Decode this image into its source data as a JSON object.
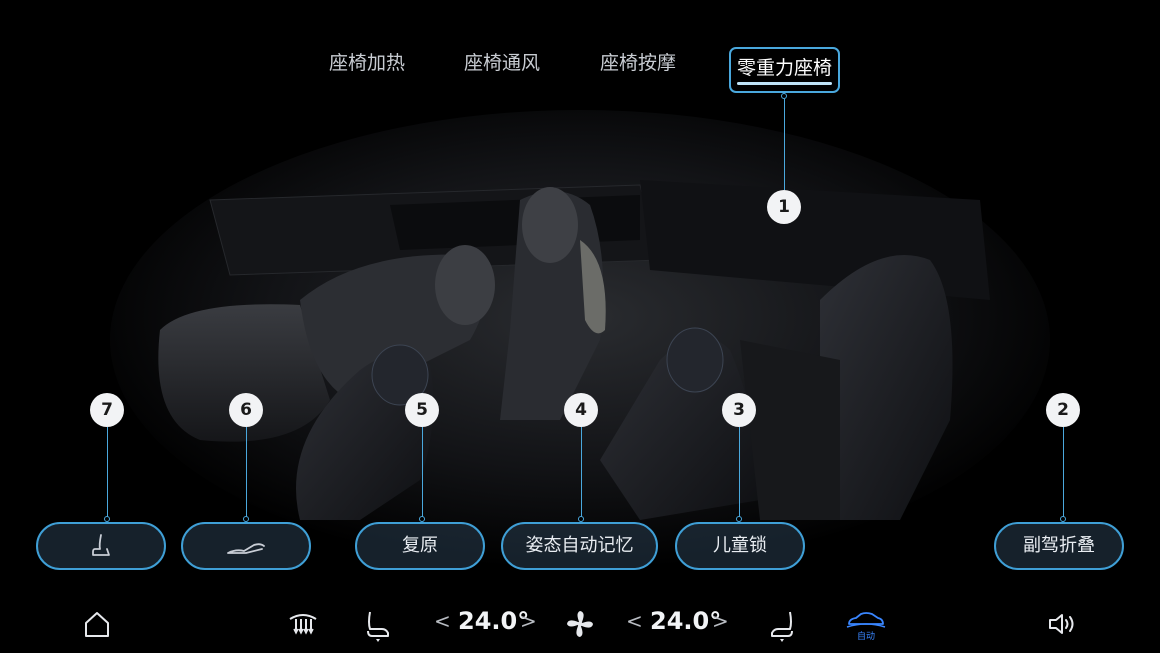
{
  "tabs": [
    {
      "label": "座椅加热",
      "active": false
    },
    {
      "label": "座椅通风",
      "active": false
    },
    {
      "label": "座椅按摩",
      "active": false
    },
    {
      "label": "零重力座椅",
      "active": true
    }
  ],
  "markers": [
    "1",
    "2",
    "3",
    "4",
    "5",
    "6",
    "7"
  ],
  "buttons": {
    "seat_icon": "seat-upright-icon",
    "recline_icon": "seat-recline-icon",
    "reset": "复原",
    "posture_memory": "姿态自动记忆",
    "child_lock": "儿童锁",
    "passenger_fold": "副驾折叠"
  },
  "climate": {
    "left_temp": "24.0°",
    "right_temp": "24.0°",
    "auto_label": "自动",
    "chevron_left": "<",
    "chevron_right": ">"
  },
  "colors": {
    "accent": "#4aa8dd",
    "auto_blue": "#3a86ff"
  }
}
